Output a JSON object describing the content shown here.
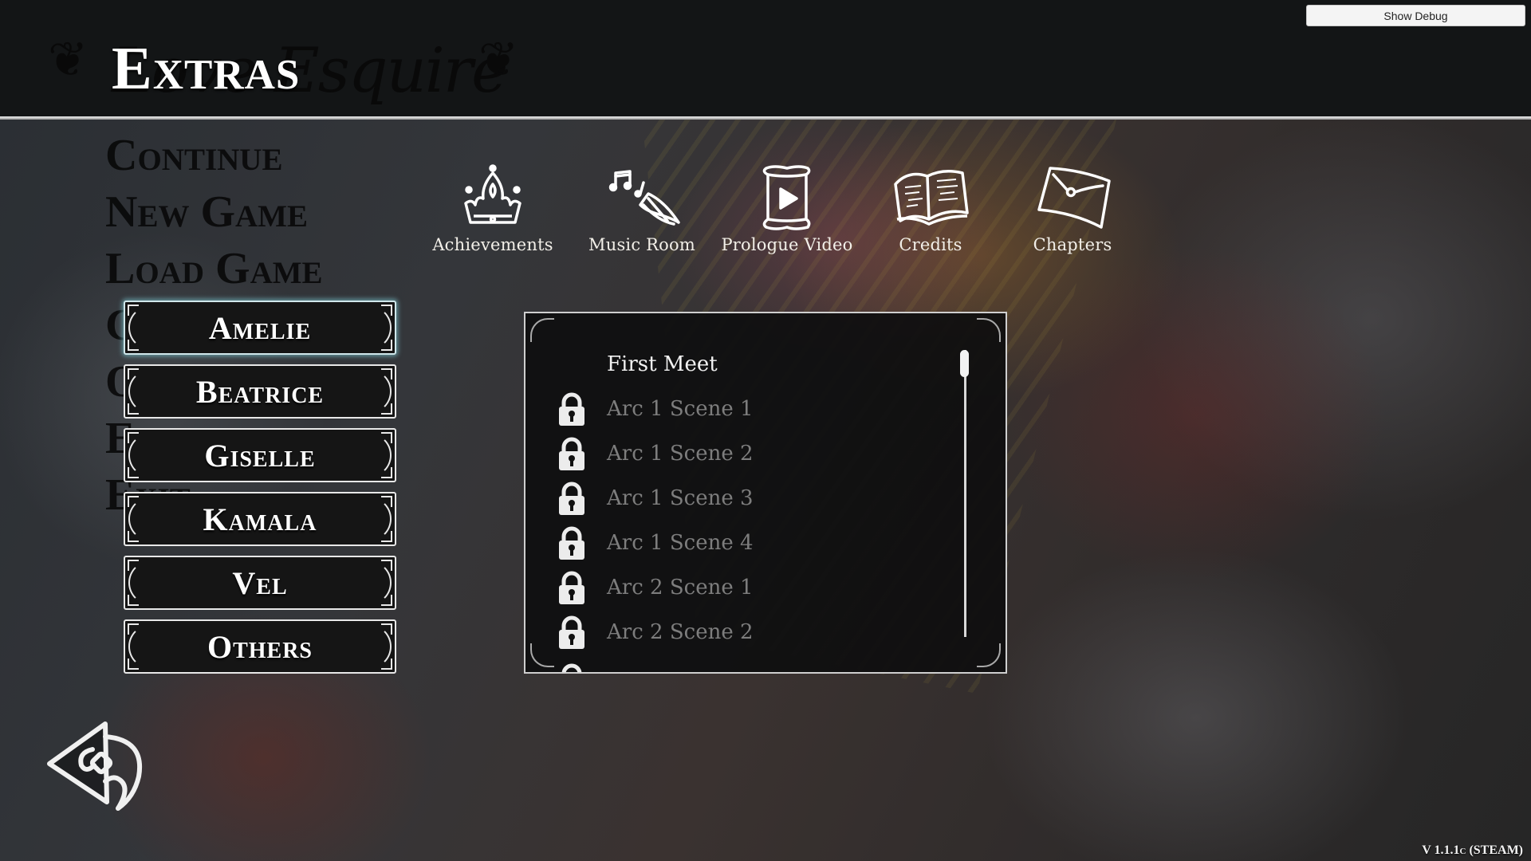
{
  "header": {
    "title": "Extras",
    "background_logo_text": "Love Esquire",
    "debug_button_label": "Show Debug"
  },
  "main_menu": {
    "items": [
      "Continue",
      "New Game",
      "Load Game",
      "Gallery",
      "Options",
      "Extras",
      "Exit"
    ]
  },
  "characters": {
    "selected": "Amelie",
    "items": [
      {
        "label": "Amelie",
        "selected": true
      },
      {
        "label": "Beatrice",
        "selected": false
      },
      {
        "label": "Giselle",
        "selected": false
      },
      {
        "label": "Kamala",
        "selected": false
      },
      {
        "label": "Vel",
        "selected": false
      },
      {
        "label": "Others",
        "selected": false
      }
    ]
  },
  "extras": {
    "items": [
      {
        "label": "Achievements",
        "icon": "crown-icon"
      },
      {
        "label": "Music Room",
        "icon": "music-horn-icon"
      },
      {
        "label": "Prologue Video",
        "icon": "scroll-play-icon"
      },
      {
        "label": "Credits",
        "icon": "open-book-icon"
      },
      {
        "label": "Chapters",
        "icon": "envelope-icon"
      }
    ]
  },
  "scenes": {
    "items": [
      {
        "label": "First Meet",
        "locked": false
      },
      {
        "label": "Arc 1 Scene 1",
        "locked": true
      },
      {
        "label": "Arc 1 Scene 2",
        "locked": true
      },
      {
        "label": "Arc 1 Scene 3",
        "locked": true
      },
      {
        "label": "Arc 1 Scene 4",
        "locked": true
      },
      {
        "label": "Arc 2 Scene 1",
        "locked": true
      },
      {
        "label": "Arc 2 Scene 2",
        "locked": true
      }
    ],
    "scroll_position": 0
  },
  "footer": {
    "version": "V 1.1.1c (STEAM)"
  },
  "colors": {
    "selected_glow": "#7ebec8",
    "locked_text": "#7d7d7d",
    "unlocked_text": "#f2f2f2",
    "header_bg": "#131516"
  }
}
